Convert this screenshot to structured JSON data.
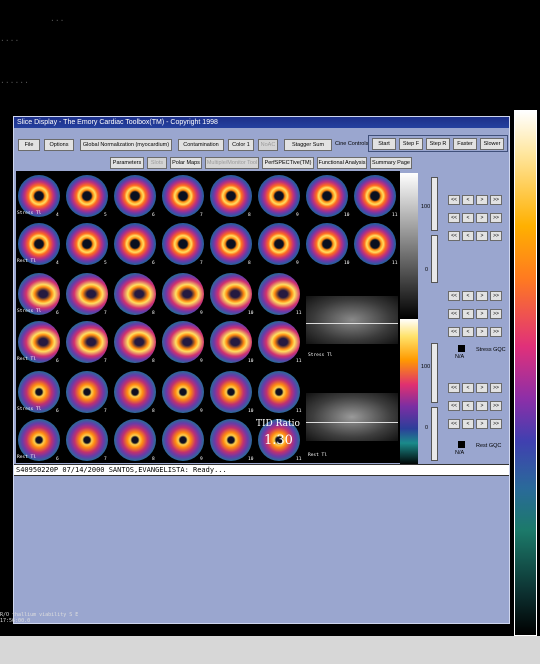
{
  "window": {
    "title": "Slice Display - The Emory Cardiac Toolbox(TM) - Copyright 1998"
  },
  "toolbar1": {
    "file": "File",
    "options": "Options",
    "global_norm": "Global Normalization (myocardium)",
    "contamination": "Contamination",
    "color": "Color 1",
    "no_ac": "NoAC",
    "stagger": "Stagger Sum",
    "cine_label": "Cine Controls",
    "start": "Start",
    "step_f": "Step F",
    "step_r": "Step R",
    "faster": "Faster",
    "slower": "Slower"
  },
  "toolbar2": {
    "parameters": "Parameters",
    "slots": "Slots",
    "polar": "Polar Maps",
    "multi": "Multiple/Monitor Tool",
    "perf": "PerfSPECTive(TM)",
    "functional": "Functional Analysis",
    "summary": "Summary Page"
  },
  "tags": {
    "stress": "Stress Tl",
    "rest": "Rest Tl"
  },
  "tid": {
    "label": "TID Ratio",
    "value": "1.30"
  },
  "scale": {
    "s100": "100",
    "s0": "0"
  },
  "nav": {
    "first": "<<",
    "prev": "<",
    "next": ">",
    "last": ">>"
  },
  "gqc": {
    "na": "N/A",
    "stress": "Stress GQC",
    "rest": "Rest GQC"
  },
  "status": "S40950220P  07/14/2000  SANTOS,EVANGELISTA:  Ready...",
  "footer": {
    "line1": "R/O thallium viability S E",
    "line2": "17:56:00.0"
  },
  "slice_numbers": {
    "short_axis": [
      "4",
      "5",
      "6",
      "7",
      "8",
      "9",
      "10",
      "11"
    ],
    "long_axis": [
      "6",
      "7",
      "8",
      "9",
      "10",
      "11"
    ]
  }
}
